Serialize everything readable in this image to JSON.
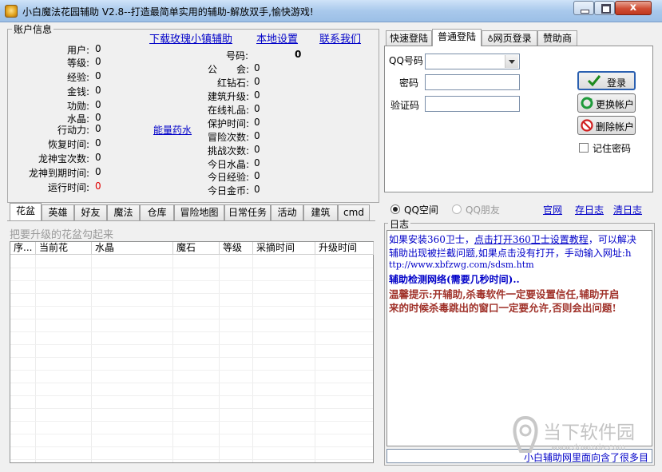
{
  "window": {
    "title": "小白魔法花园辅助 V2.8--打造最简单实用的辅助-解放双手,愉快游戏!",
    "close_glyph": "x"
  },
  "account": {
    "group_label": "账户信息",
    "links": {
      "download": "下载玫瑰小镇辅助",
      "local_settings": "本地设置",
      "contact": "联系我们",
      "energy_potion": "能量药水"
    },
    "left_fields": [
      {
        "label": "用户:",
        "value": "0"
      },
      {
        "label": "等级:",
        "value": "0"
      },
      {
        "label": "经验:",
        "value": "0"
      },
      {
        "label": "金钱:",
        "value": "0"
      },
      {
        "label": "功勋:",
        "value": "0"
      },
      {
        "label": "水晶:",
        "value": "0"
      },
      {
        "label": "行动力:",
        "value": "0"
      },
      {
        "label": "恢复时间:",
        "value": "0"
      },
      {
        "label": "龙神宝次数:",
        "value": "0"
      },
      {
        "label": "龙神到期时间:",
        "value": "0"
      },
      {
        "label": "运行时间:",
        "value": "0"
      }
    ],
    "right_top": {
      "label": "号码:",
      "value": "0"
    },
    "right_fields": [
      {
        "label": "公　　会:",
        "value": "0"
      },
      {
        "label": "红钻石:",
        "value": "0"
      },
      {
        "label": "建筑升级:",
        "value": "0"
      },
      {
        "label": "在线礼品:",
        "value": "0"
      },
      {
        "label": "保护时间:",
        "value": "0"
      },
      {
        "label": "冒险次数:",
        "value": "0"
      },
      {
        "label": "挑战次数:",
        "value": "0"
      },
      {
        "label": "今日水晶:",
        "value": "0"
      },
      {
        "label": "今日经验:",
        "value": "0"
      },
      {
        "label": "今日金币:",
        "value": "0"
      }
    ],
    "runtime_color": "#e00000"
  },
  "login": {
    "tabs": [
      "快速登陆",
      "普通登陆",
      "网页登录",
      "赞助商"
    ],
    "active_tab": 1,
    "qq_label": "QQ号码",
    "password_label": "密码",
    "captcha_label": "验证码",
    "qq_value": "",
    "password_value": "",
    "captcha_value": "",
    "login_button": "登录",
    "switch_button": "更换帐户",
    "delete_button": "删除帐户",
    "remember_label": "记住密码"
  },
  "space": {
    "qq_zone": "QQ空间",
    "qq_friends": "QQ朋友",
    "links": [
      "官网",
      "存日志",
      "清日志"
    ]
  },
  "log": {
    "group_label": "日志",
    "lines": [
      {
        "text": "如果安装360卫士，",
        "color": "#0000c8"
      },
      {
        "text": "点击打开360卫士设置教程",
        "color": "#0000c8"
      },
      {
        "text": "，可以解决",
        "color": "#0000c8"
      },
      {
        "text": "辅助出现被拦截问题,如果点击没有打开，手动输入网址:h",
        "color": "#0000c8"
      },
      {
        "text": "ttp://www.xbfzwg.com/sdsm.htm",
        "color": "#0000c8"
      },
      {
        "text": "辅助检测网络(需要几秒时间)..",
        "color": "#0000c8"
      },
      {
        "text": "温馨提示:开辅助,杀毒软件一定要设置信任,辅助开启",
        "color": "#a0322a"
      },
      {
        "text": "来的时候杀毒跳出的窗口一定要允许,否则会出问题!",
        "color": "#a0322a"
      }
    ],
    "footer": "小白辅助网里面向含了很多目"
  },
  "bottom_tabs": {
    "tabs": [
      "花盆",
      "英雄",
      "好友",
      "魔法",
      "仓库",
      "冒险地图",
      "日常任务",
      "活动",
      "建筑",
      "cmd"
    ],
    "active_tab": 0,
    "hint": "把要升级的花盆勾起来",
    "columns": [
      "序...",
      "当前花",
      "水晶",
      "魔石",
      "等级",
      "采摘时间",
      "升级时间"
    ]
  },
  "watermark": {
    "brand": "当下软件园",
    "url": "www.downxia.com"
  }
}
